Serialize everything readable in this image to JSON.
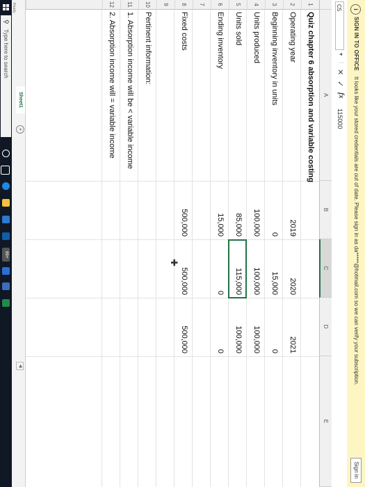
{
  "message_bar": {
    "title": "SIGN IN TO OFFICE",
    "message": "It looks like your stored credentials are out of date. Please sign in as da*****@hotmail.com so we can verify your subscription.",
    "sign_in_label": "Sign in"
  },
  "formula_bar": {
    "name_box": "C5",
    "fx": "fx",
    "value": "115000"
  },
  "columns": [
    "A",
    "B",
    "C",
    "D",
    "E"
  ],
  "selected_column": "C",
  "rows": [
    "1",
    "2",
    "3",
    "4",
    "5",
    "6",
    "7",
    "8",
    "9",
    "10",
    "11",
    "12"
  ],
  "sheet": {
    "title": "Quiz chapter 6 absorption and variable costing",
    "operating_year_label": "Operating year",
    "years": [
      "2019",
      "2020",
      "2021"
    ],
    "beginning_inventory_label": "Beginning inventory in units",
    "beginning_inventory": [
      "0",
      "15,000",
      "0"
    ],
    "units_produced_label": "Units produced",
    "units_produced": [
      "100,000",
      "100,000",
      "100,000"
    ],
    "units_sold_label": "Units sold",
    "units_sold": [
      "85,000",
      "115,000",
      "100,000"
    ],
    "ending_inventory_label": "Ending inventory",
    "ending_inventory": [
      "15,000",
      "0",
      "0"
    ],
    "fixed_costs_label": "Fixed costs",
    "fixed_costs": [
      "500,000",
      "500,000",
      "500,000"
    ],
    "pertinent_label": "Pertinent information:",
    "info_1": "1. Absorption income will be < variable income",
    "info_2": "2. Absorption income will = variable income"
  },
  "tabs": {
    "sheet1": "Sheet1",
    "add": "+"
  },
  "status": "Ready",
  "taskbar": {
    "search_placeholder": "Type here to search",
    "badge": "99+"
  }
}
